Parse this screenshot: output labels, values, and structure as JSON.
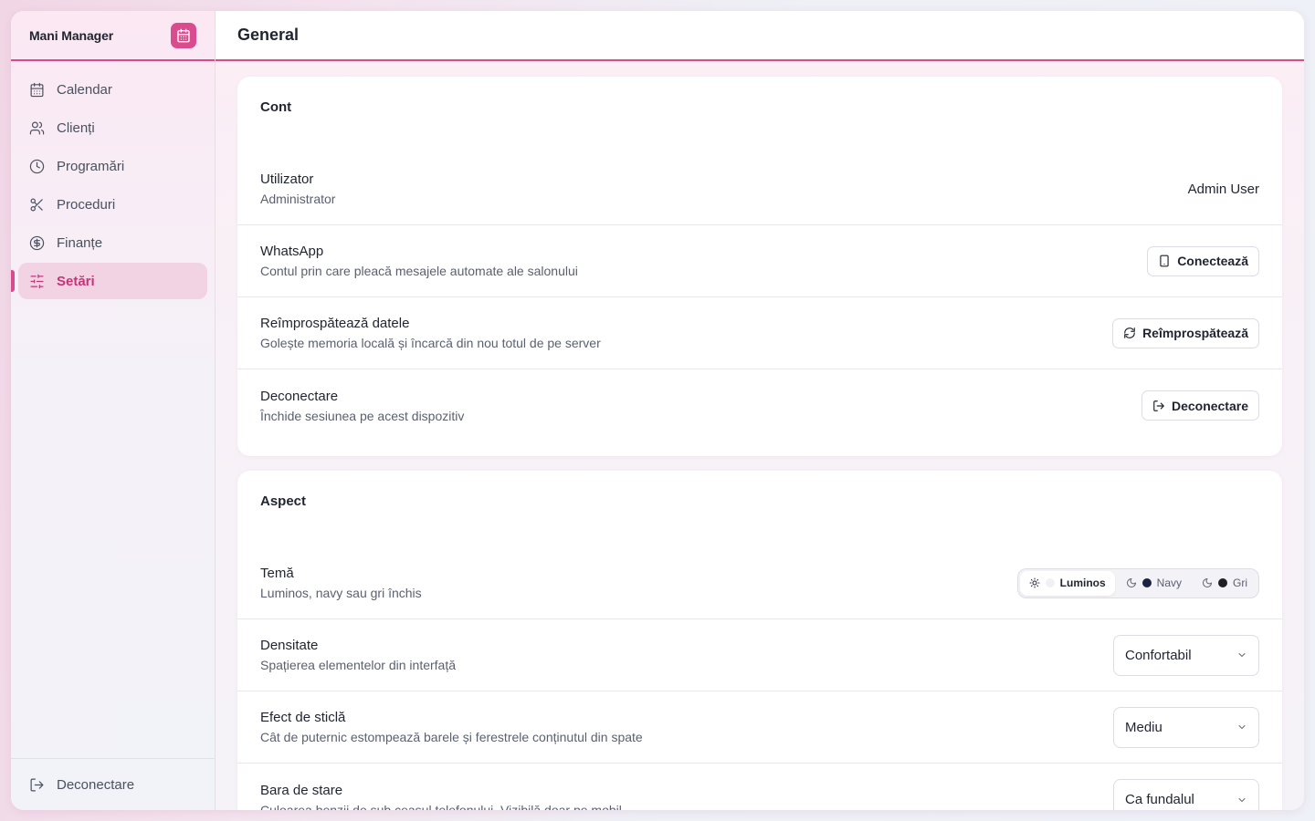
{
  "app": {
    "name": "Mani Manager",
    "logo_icon": "calendar-icon",
    "accent": "#d84a8c"
  },
  "sidebar": {
    "items": [
      {
        "label": "Calendar",
        "icon": "calendar-icon",
        "active": false
      },
      {
        "label": "Clienți",
        "icon": "users-icon",
        "active": false
      },
      {
        "label": "Programări",
        "icon": "clock-icon",
        "active": false
      },
      {
        "label": "Proceduri",
        "icon": "scissors-icon",
        "active": false
      },
      {
        "label": "Finanțe",
        "icon": "dollar-circle-icon",
        "active": false
      },
      {
        "label": "Setări",
        "icon": "sliders-icon",
        "active": true
      }
    ],
    "footer_label": "Deconectare",
    "footer_icon": "logout-icon"
  },
  "header": {
    "title": "General"
  },
  "account": {
    "title": "Cont",
    "user": {
      "label": "Utilizator",
      "desc": "Administrator",
      "value": "Admin User"
    },
    "whatsapp": {
      "label": "WhatsApp",
      "desc": "Contul prin care pleacă mesajele automate ale salonului",
      "button": "Conectează",
      "icon": "phone-icon"
    },
    "refresh": {
      "label": "Reîmprospătează datele",
      "desc": "Golește memoria locală și încarcă din nou totul de pe server",
      "button": "Reîmprospătează",
      "icon": "refresh-icon"
    },
    "logout": {
      "label": "Deconectare",
      "desc": "Închide sesiunea pe acest dispozitiv",
      "button": "Deconectare",
      "icon": "logout-icon"
    }
  },
  "appearance": {
    "title": "Aspect",
    "theme": {
      "label": "Temă",
      "desc": "Luminos, navy sau gri închis",
      "options": [
        {
          "label": "Luminos",
          "icon": "sun-icon",
          "dot_color": "#f1f1f4",
          "selected": true
        },
        {
          "label": "Navy",
          "icon": "moon-icon",
          "dot_color": "#1b2440",
          "selected": false
        },
        {
          "label": "Gri",
          "icon": "moon-icon",
          "dot_color": "#1f2024",
          "selected": false
        }
      ]
    },
    "density": {
      "label": "Densitate",
      "desc": "Spațierea elementelor din interfață",
      "value": "Confortabil"
    },
    "glass": {
      "label": "Efect de sticlă",
      "desc": "Cât de puternic estompează barele și ferestrele conținutul din spate",
      "value": "Mediu"
    },
    "statusbar": {
      "label": "Bara de stare",
      "desc": "Culoarea benzii de sub ceasul telefonului. Vizibilă doar pe mobil.",
      "value": "Ca fundalul"
    }
  }
}
